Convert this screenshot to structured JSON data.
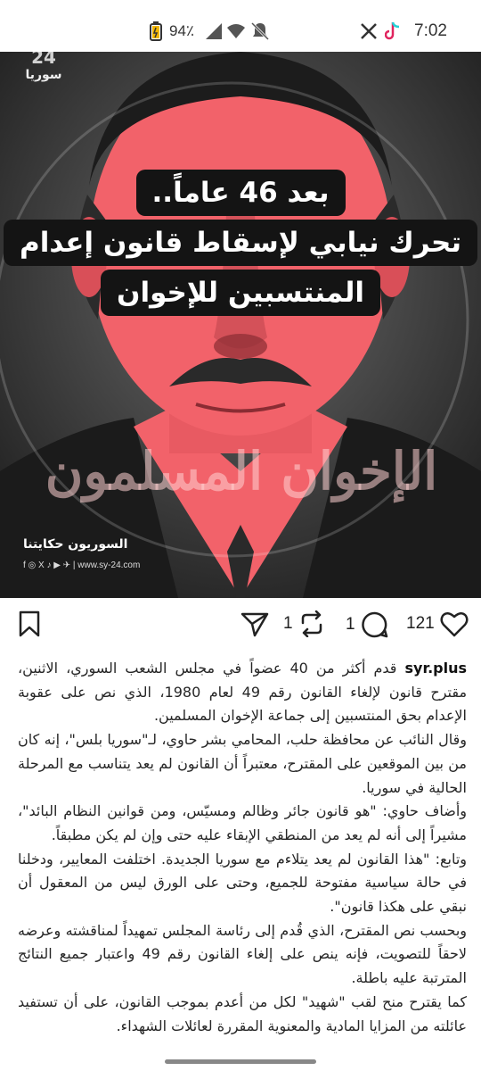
{
  "status_bar": {
    "time": "7:02",
    "battery": "94٪",
    "icons": [
      "x-icon",
      "tiktok-icon",
      "mute-icon",
      "wifi-icon",
      "signal-icon",
      "battery-icon"
    ]
  },
  "post_image": {
    "logo_number": "24",
    "logo_text": "سوريا",
    "headline": [
      "بعد 46 عاماً..",
      "تحرك نيابي لإسقاط قانون إعدام",
      "المنتسبين للإخوان"
    ],
    "watermark": "الإخوان المسلمون",
    "footer_brand": "السوريون حكايتنا",
    "footer_social": "f ◎ X ♪ ▶ ✈ | www.sy-24.com"
  },
  "actions": {
    "like_count": "121",
    "comment_count": "1",
    "repost_count": "1",
    "share_count": ""
  },
  "post": {
    "username": "syr.plus",
    "paragraphs": [
      "قدم أكثر من 40 عضواً في مجلس الشعب السوري، الاثنين، مقترح قانون لإلغاء القانون رقم 49 لعام 1980، الذي نص على عقوبة الإعدام بحق المنتسبين إلى جماعة الإخوان المسلمين.",
      "وقال النائب عن محافظة حلب، المحامي بشر حاوي، لـ\"سوريا بلس\"، إنه كان من بين الموقعين على المقترح، معتبراً أن القانون لم يعد يتناسب مع المرحلة الحالية في سوريا.",
      "وأضاف حاوي: \"هو قانون جائر وظالم ومسيّس، ومن قوانين النظام البائد\"، مشيراً إلى أنه لم يعد من المنطقي الإبقاء عليه حتى وإن لم يكن مطبقاً.",
      "وتابع: \"هذا القانون لم يعد يتلاءم مع سوريا الجديدة. اختلفت المعايير، ودخلنا في حالة سياسية مفتوحة للجميع، وحتى على الورق ليس من المعقول أن نبقي على هكذا قانون\".",
      "وبحسب نص المقترح، الذي قُدم إلى رئاسة المجلس تمهيداً لمناقشته وعرضه لاحقاً للتصويت، فإنه ينص على إلغاء القانون رقم 49 واعتبار جميع النتائج المترتبة عليه باطلة.",
      "كما يقترح منح لقب \"شهيد\" لكل من أعدم بموجب القانون، على أن تستفيد عائلته من المزايا المادية والمعنوية المقررة لعائلات الشهداء."
    ]
  },
  "colors": {
    "accent_red": "#f2626a",
    "headline_bg": "#141414"
  }
}
